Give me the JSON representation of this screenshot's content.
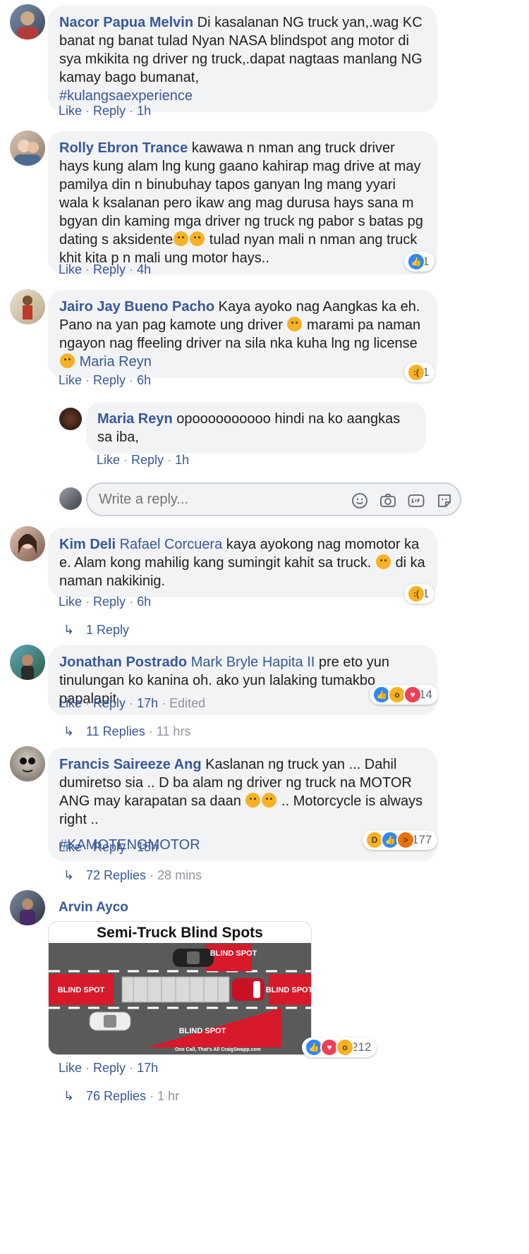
{
  "comments": [
    {
      "name": "Nacor Papua Melvin",
      "text": "Di kasalanan NG truck yan,.wag KC banat ng banat tulad Nyan NASA blindspot ang motor di sya mkikita ng driver ng truck,.dapat nagtaas manlang NG kamay bago bumanat,",
      "hashtag": "#kulangsaexperience",
      "like": "Like",
      "reply": "Reply",
      "time": "1h"
    },
    {
      "name": "Rolly Ebron Trance",
      "text1": "kawawa n nman ang truck driver hays kung alam lng kung gaano kahirap mag drive at may pamilya din n binubuhay tapos ganyan lng mang yyari wala k ksalanan pero ikaw ang mag durusa hays sana m bgyan din kaming mga driver ng truck ng pabor s batas pg dating s aksidente",
      "text2": "tulad nyan mali n nman ang truck khit kita p n mali ung motor hays..",
      "like": "Like",
      "reply": "Reply",
      "time": "4h",
      "reaction_count": "1"
    },
    {
      "name": "Jairo Jay Bueno Pacho",
      "text1": "Kaya ayoko nag Aangkas ka eh. Pano na yan pag kamote ung driver",
      "text2": "marami pa naman ngayon nag ffeeling driver na sila nka kuha lng ng license",
      "mention": "Maria Reyn",
      "like": "Like",
      "reply": "Reply",
      "time": "6h",
      "reaction_count": "1"
    },
    {
      "name": "Maria Reyn",
      "text": "opoooooooooo hindi na ko aangkas sa iba,",
      "like": "Like",
      "reply": "Reply",
      "time": "1h"
    },
    {
      "name": "Kim Deli",
      "mention": "Rafael Corcuera",
      "text1": "kaya ayokong nag momotor ka e. Alam kong mahilig kang sumingit kahit sa truck.",
      "text2": "di ka naman nakikinig.",
      "like": "Like",
      "reply": "Reply",
      "time": "6h",
      "reaction_count": "1",
      "replies": "1 Reply"
    },
    {
      "name": "Jonathan Postrado",
      "mention": "Mark Bryle Hapita II",
      "text": "pre eto yun tinulungan ko kanina oh. ako yun lalaking tumakbo papalapit",
      "like": "Like",
      "reply": "Reply",
      "time": "17h",
      "edited": "Edited",
      "reaction_count": "14",
      "replies": "11 Replies",
      "replies_time": "11 hrs"
    },
    {
      "name": "Francis Saireeze Ang",
      "text1": "Kaslanan ng truck yan ... Dahil dumiretso sia .. D ba alam ng driver ng truck na MOTOR ANG may karapatan sa daan",
      "text2": ".. Motorcycle is always right ..",
      "hashtag": "#KAMOTENGMOTOR",
      "like": "Like",
      "reply": "Reply",
      "time": "15h",
      "reaction_count": "177",
      "replies": "72 Replies",
      "replies_time": "28 mins"
    },
    {
      "name": "Arvin Ayco",
      "image_title": "Semi-Truck Blind Spots",
      "blind_spot_1": "BLIND SPOT",
      "blind_spot_2": "BLIND SPOT",
      "blind_spot_3": "BLIND SPOT",
      "blind_spot_4": "BLIND SPOT",
      "image_footer": "One Call, That's All  CraigSwapp.com",
      "like": "Like",
      "reply": "Reply",
      "time": "17h",
      "reaction_count": "212",
      "replies": "76 Replies",
      "replies_time": "1 hr"
    }
  ],
  "write_reply": {
    "placeholder": "Write a reply..."
  },
  "separator": "·",
  "icons": [
    "like-icon",
    "love-icon",
    "wow-icon",
    "sad-icon",
    "haha-icon",
    "angry-icon",
    "reply-arrow-icon",
    "smiley-icon",
    "camera-icon",
    "gif-icon",
    "sticker-icon"
  ],
  "colors": {
    "link": "#385898",
    "bubble": "#f2f3f5",
    "like": "#2d88ff",
    "love": "#f33e58",
    "reaction_yellow": "#f7b125",
    "image_red": "#d7192a",
    "road_gray": "#555555"
  }
}
